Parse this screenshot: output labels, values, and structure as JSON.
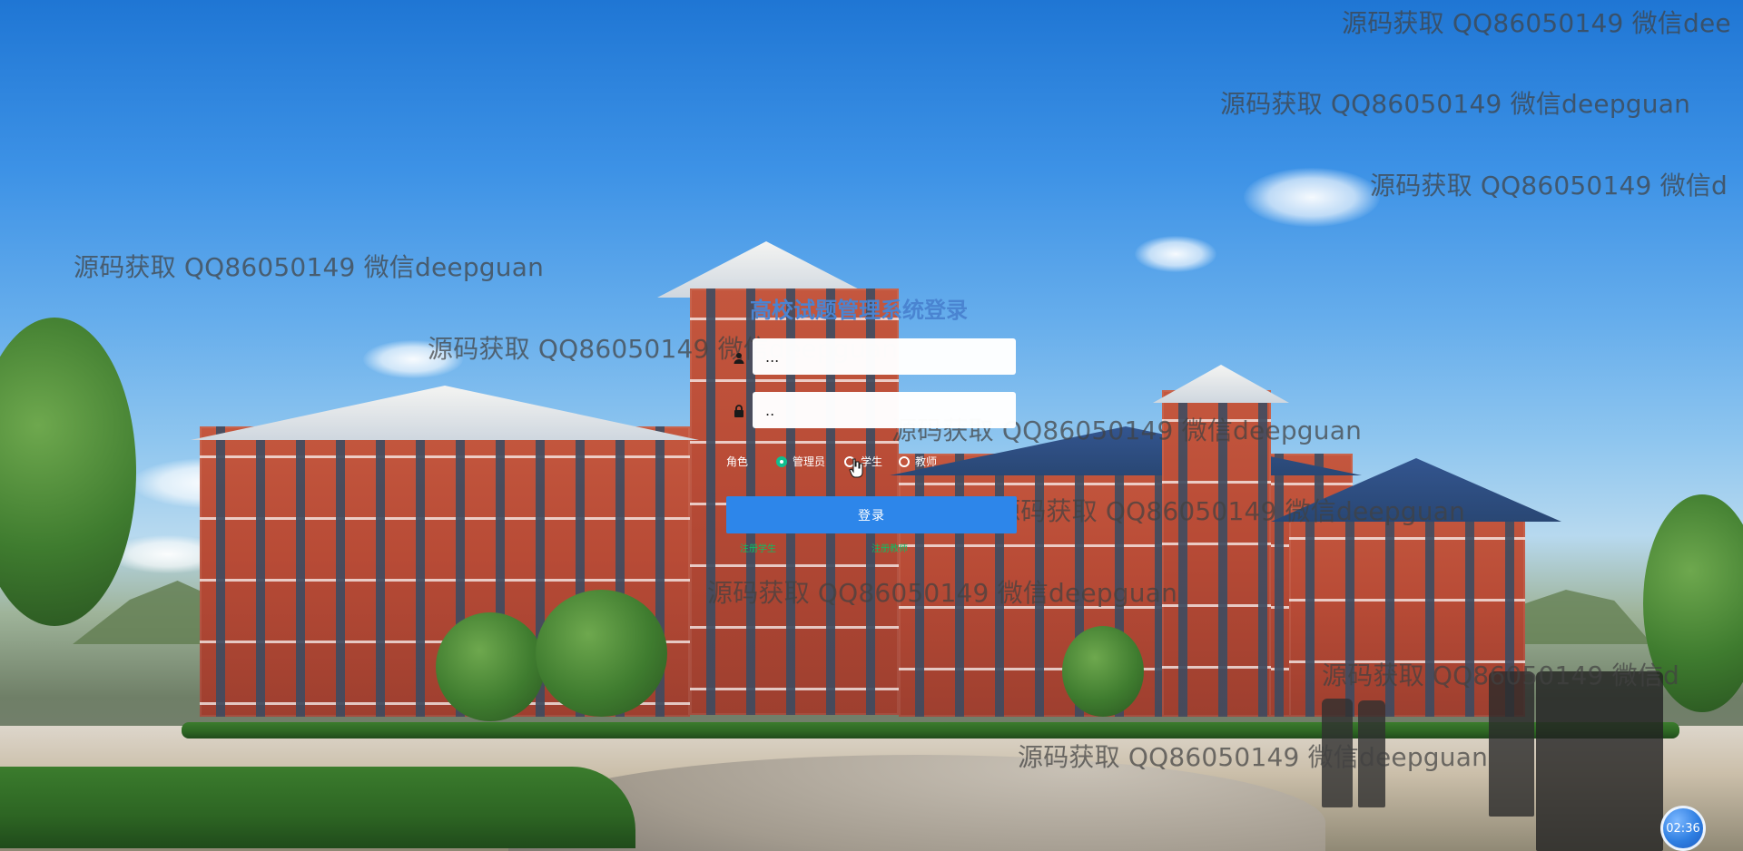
{
  "watermarks": [
    "源码获取 QQ86050149 微信dee",
    "源码获取 QQ86050149 微信deepguan",
    "源码获取 QQ86050149 微信d",
    "源码获取 QQ86050149 微信deepguan",
    "源码获取 QQ86050149 微信deepguan",
    "源码获取 QQ86050149 微信deepguan",
    "源码获取 QQ86050149 微信deepguan",
    "源码获取 QQ86050149 微信deepguan",
    "源码获取 QQ86050149 微信d",
    "源码获取 QQ86050149 微信deepguan"
  ],
  "login": {
    "title": "高校试题管理系统登录",
    "username_value": "...",
    "password_value": "..",
    "role_label": "角色",
    "roles": [
      "管理员",
      "学生",
      "教师"
    ],
    "selected_role": "管理员",
    "submit_label": "登录",
    "register_student_label": "注册学生",
    "register_teacher_label": "注册教师"
  },
  "status": {
    "timer": "02:36"
  },
  "colors": {
    "title": "#4a84d1",
    "button": "#2d86ea",
    "radio_checked": "#0fbf8f",
    "link": "#0fbf62"
  }
}
